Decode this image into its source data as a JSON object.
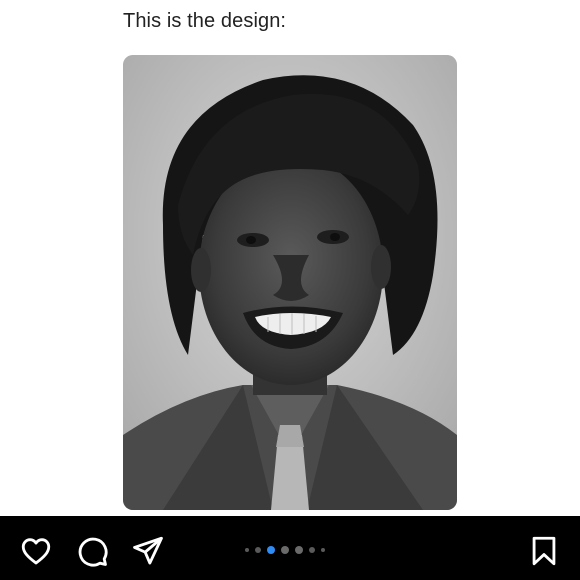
{
  "post": {
    "caption": "This is the design:"
  },
  "carousel": {
    "dot_count": 7,
    "active_index": 2
  },
  "actions": {
    "like_icon": "heart-icon",
    "comment_icon": "comment-icon",
    "share_icon": "send-icon",
    "save_icon": "bookmark-icon"
  },
  "colors": {
    "bar_background": "#000000",
    "active_dot": "#2f8cf5",
    "inactive_dot": "#5a5a5a"
  }
}
